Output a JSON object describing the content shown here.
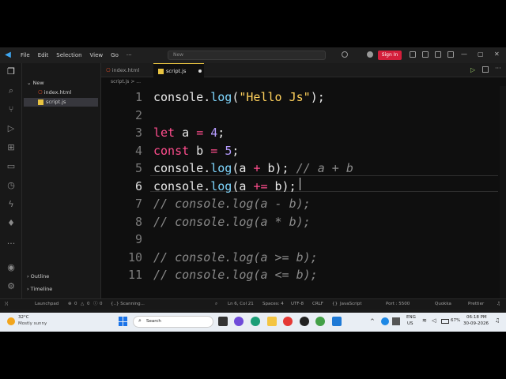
{
  "titlebar": {
    "menus": [
      "File",
      "Edit",
      "Selection",
      "View",
      "Go",
      "···"
    ],
    "command_center": "New",
    "signin_label": "Sign In"
  },
  "sidebar": {
    "folder": "New",
    "files": [
      "index.html",
      "script.js"
    ],
    "outline": "Outline",
    "timeline": "Timeline"
  },
  "tabs": [
    {
      "label": "index.html"
    },
    {
      "label": "script.js"
    }
  ],
  "breadcrumb": "script.js > ...",
  "editor": {
    "line_numbers": [
      "1",
      "2",
      "3",
      "4",
      "5",
      "6",
      "7",
      "8",
      "9",
      "10",
      "11"
    ],
    "lines": [
      "console.log(\"Hello Js\");",
      "",
      "let a = 4;",
      "const b = 5;",
      "console.log(a + b); // a + b",
      "console.log(a += b);",
      "// console.log(a - b);",
      "// console.log(a * b);",
      "",
      "// console.log(a >= b);",
      "// console.log(a <= b);"
    ]
  },
  "statusbar": {
    "launchpad": "Launchpad",
    "errors": "0",
    "warnings": "0",
    "info": "0",
    "scanning": "{..} Scanning...",
    "position": "Ln 6, Col 21",
    "spaces": "Spaces: 4",
    "encoding": "UTF-8",
    "eol": "CRLF",
    "language": "JavaScript",
    "port": "Port : 5500",
    "quokka": "Quokka",
    "prettier": "Prettier"
  },
  "taskbar": {
    "weather_temp": "32°C",
    "weather_desc": "Mostly sunny",
    "search_placeholder": "Search",
    "lang": "ENG",
    "region": "US",
    "battery": "67%",
    "time": "06:18 PM",
    "date": "30-09-2026"
  }
}
